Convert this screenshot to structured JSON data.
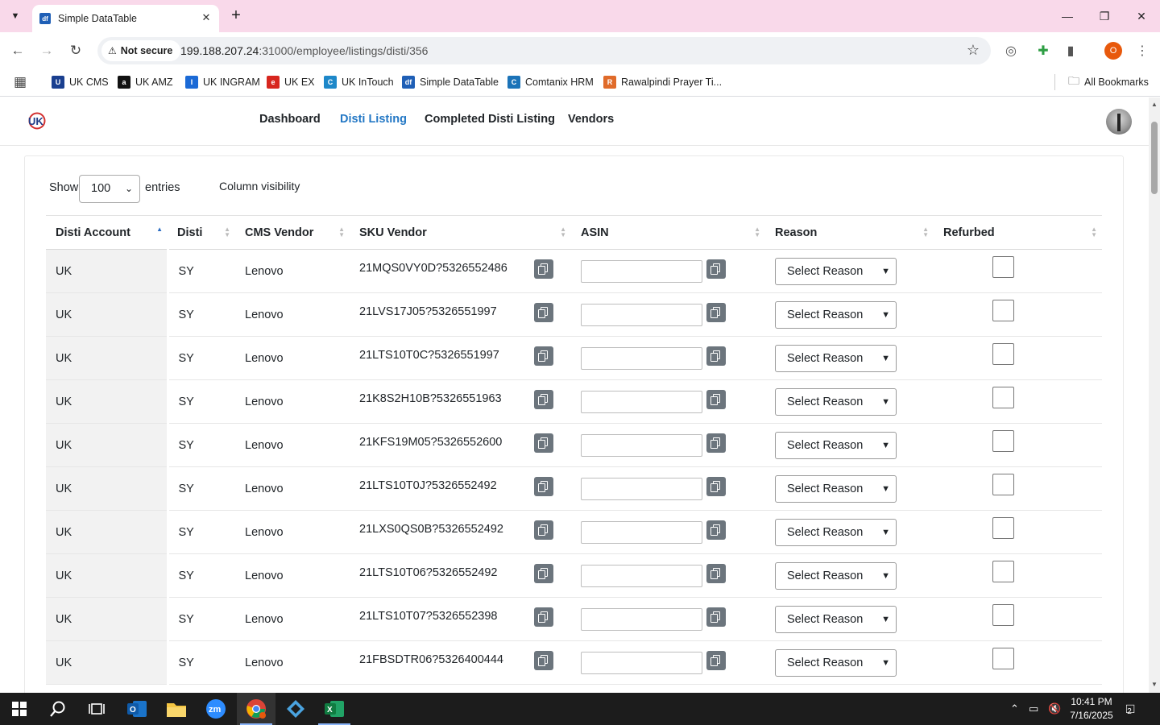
{
  "browser": {
    "tab_title": "Simple DataTable",
    "tab_favicon": "df",
    "security_label": "Not secure",
    "url_host": "199.188.207.24",
    "url_path": ":31000/employee/listings/disti/356",
    "profile_initial": "O"
  },
  "bookmarks": [
    {
      "label": "UK CMS",
      "icon_color": "#1a3f8f",
      "glyph": "U"
    },
    {
      "label": "UK AMZ",
      "icon_color": "#111111",
      "glyph": "a"
    },
    {
      "label": "UK INGRAM",
      "icon_color": "#1b6ad6",
      "glyph": "I"
    },
    {
      "label": "UK EX",
      "icon_color": "#d7261e",
      "glyph": "e"
    },
    {
      "label": "UK InTouch",
      "icon_color": "#1e88c9",
      "glyph": "C"
    },
    {
      "label": "Simple DataTable",
      "icon_color": "#1f5fb6",
      "glyph": "df"
    },
    {
      "label": "Comtanix HRM",
      "icon_color": "#1b73b8",
      "glyph": "C"
    },
    {
      "label": "Rawalpindi Prayer Ti...",
      "icon_color": "#e06b2a",
      "glyph": "R"
    }
  ],
  "all_bookmarks_label": "All Bookmarks",
  "nav": {
    "dashboard": "Dashboard",
    "disti_listing": "Disti Listing",
    "completed": "Completed Disti Listing",
    "vendors": "Vendors"
  },
  "controls": {
    "show_label": "Show",
    "entries_value": "100",
    "entries_label": "entries",
    "column_visibility": "Column visibility"
  },
  "table": {
    "headers": {
      "disti_account": "Disti Account",
      "disti": "Disti",
      "cms_vendor": "CMS Vendor",
      "sku_vendor": "SKU Vendor",
      "asin": "ASIN",
      "reason": "Reason",
      "refurbed": "Refurbed"
    },
    "reason_placeholder": "Select Reason",
    "rows": [
      {
        "account": "UK",
        "disti": "SY",
        "vendor": "Lenovo",
        "sku": "21MQS0VY0D?5326552486"
      },
      {
        "account": "UK",
        "disti": "SY",
        "vendor": "Lenovo",
        "sku": "21LVS17J05?5326551997"
      },
      {
        "account": "UK",
        "disti": "SY",
        "vendor": "Lenovo",
        "sku": "21LTS10T0C?5326551997"
      },
      {
        "account": "UK",
        "disti": "SY",
        "vendor": "Lenovo",
        "sku": "21K8S2H10B?5326551963"
      },
      {
        "account": "UK",
        "disti": "SY",
        "vendor": "Lenovo",
        "sku": "21KFS19M05?5326552600"
      },
      {
        "account": "UK",
        "disti": "SY",
        "vendor": "Lenovo",
        "sku": "21LTS10T0J?5326552492"
      },
      {
        "account": "UK",
        "disti": "SY",
        "vendor": "Lenovo",
        "sku": "21LXS0QS0B?5326552492"
      },
      {
        "account": "UK",
        "disti": "SY",
        "vendor": "Lenovo",
        "sku": "21LTS10T06?5326552492"
      },
      {
        "account": "UK",
        "disti": "SY",
        "vendor": "Lenovo",
        "sku": "21LTS10T07?5326552398"
      },
      {
        "account": "UK",
        "disti": "SY",
        "vendor": "Lenovo",
        "sku": "21FBSDTR06?5326400444"
      }
    ]
  },
  "taskbar": {
    "time": "10:41 PM",
    "date": "7/16/2025",
    "notification_count": "2"
  }
}
